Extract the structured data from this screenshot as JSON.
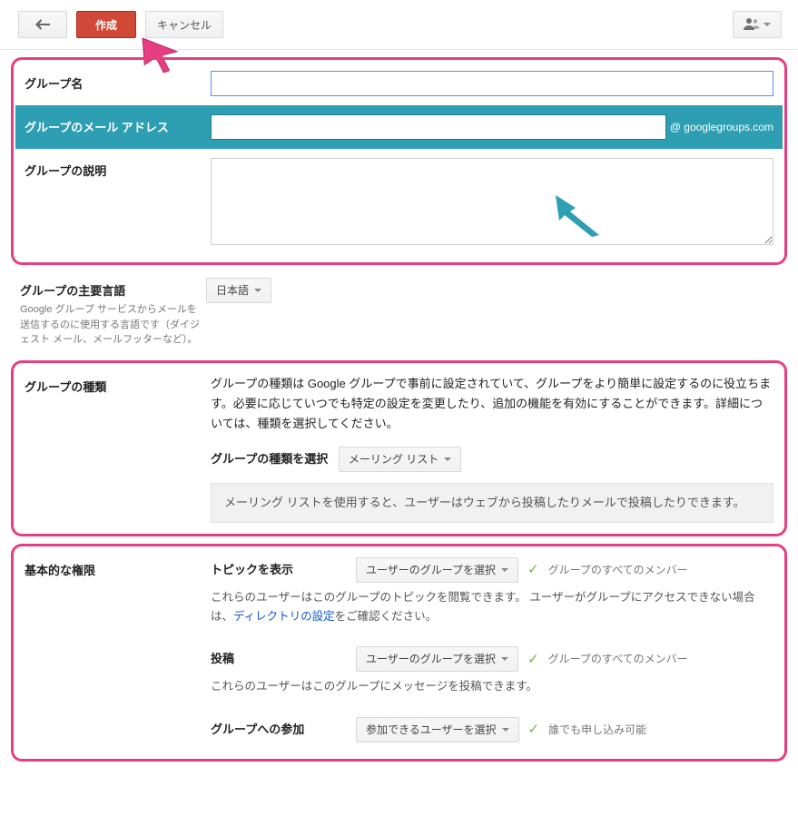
{
  "toolbar": {
    "create": "作成",
    "cancel": "キャンセル"
  },
  "fields": {
    "group_name_label": "グループ名",
    "group_name_value": "",
    "group_email_label": "グループのメール アドレス",
    "group_email_value": "",
    "email_domain": "@ googlegroups.com",
    "group_desc_label": "グループの説明",
    "group_desc_value": ""
  },
  "language": {
    "label": "グループの主要言語",
    "sub": "Google グループ サービスからメールを送信するのに使用する言語です（ダイジェスト メール、メールフッターなど）。",
    "selected": "日本語"
  },
  "group_type": {
    "label": "グループの種類",
    "desc": "グループの種類は Google グループで事前に設定されていて、グループをより簡単に設定するのに役立ちます。必要に応じていつでも特定の設定を変更したり、追加の機能を有効にすることができます。詳細については、種類を選択してください。",
    "select_label": "グループの種類を選択",
    "selected": "メーリング リスト",
    "info": "メーリング リストを使用すると、ユーザーはウェブから投稿したりメールで投稿したりできます。"
  },
  "permissions": {
    "section_label": "基本的な権限",
    "topic": {
      "title": "トピックを表示",
      "select": "ユーザーのグループを選択",
      "all": "グループのすべてのメンバー",
      "desc_before": "これらのユーザーはこのグループのトピックを閲覧できます。 ユーザーがグループにアクセスできない場合は、",
      "desc_link": "ディレクトリの設定",
      "desc_after": "をご確認ください。"
    },
    "post": {
      "title": "投稿",
      "select": "ユーザーのグループを選択",
      "all": "グループのすべてのメンバー",
      "desc": "これらのユーザーはこのグループにメッセージを投稿できます。"
    },
    "join": {
      "title": "グループへの参加",
      "select": "参加できるユーザーを選択",
      "all": "誰でも申し込み可能"
    }
  }
}
